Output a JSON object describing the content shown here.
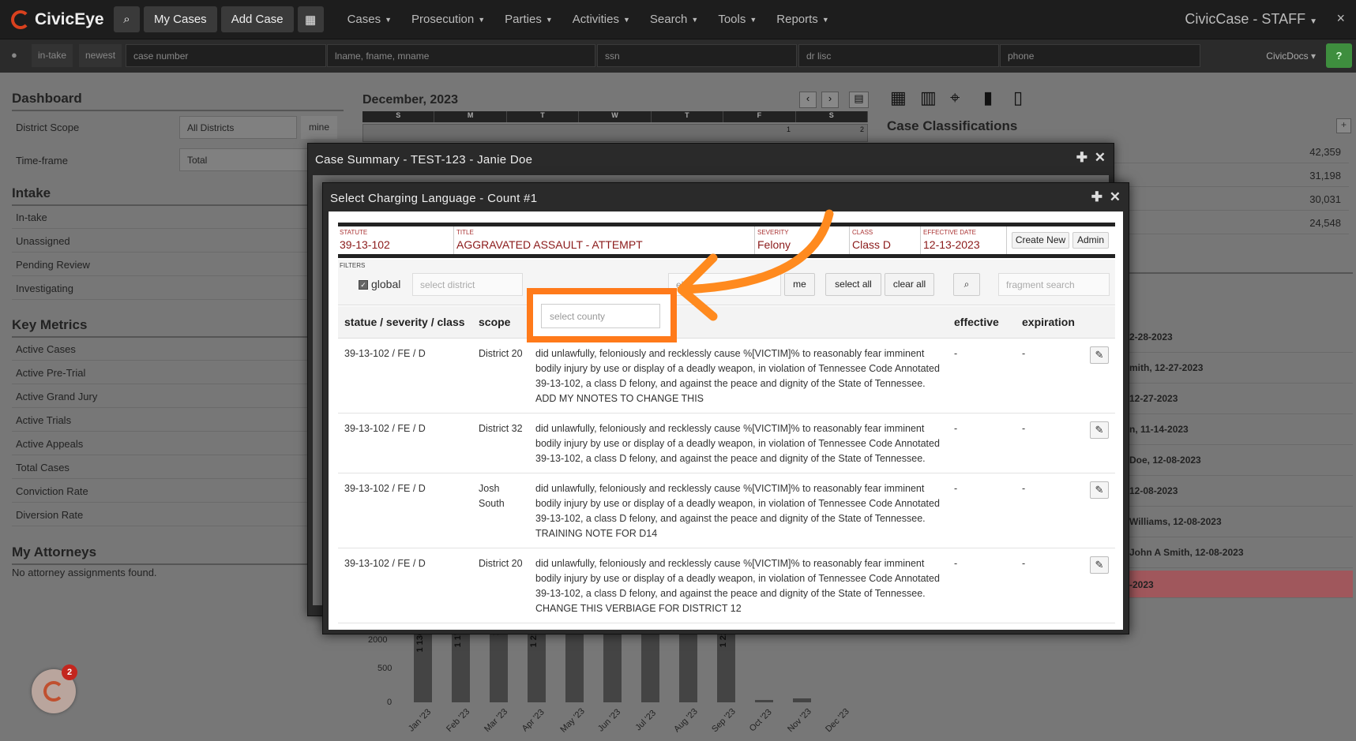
{
  "nav": {
    "brand": "CivicEye",
    "my_cases": "My Cases",
    "add_case": "Add Case",
    "menus": [
      "Cases",
      "Prosecution",
      "Parties",
      "Activities",
      "Search",
      "Tools",
      "Reports"
    ],
    "app_title": "CivicCase - STAFF",
    "close": "×"
  },
  "search_bar": {
    "in_take": "in-take",
    "newest": "newest",
    "placeholders": [
      "case number",
      "lname, fname, mname",
      "ssn",
      "dr lisc",
      "phone"
    ],
    "docs": "CivicDocs",
    "help": "?"
  },
  "dashboard": {
    "title": "Dashboard",
    "district_scope_label": "District Scope",
    "district_scope_value": "All Districts",
    "mine": "mine",
    "timeframe_label": "Time-frame",
    "timeframe_value": "Total",
    "intake_title": "Intake",
    "intake": [
      "In-take",
      "Unassigned",
      "Pending Review",
      "Investigating"
    ],
    "metrics_title": "Key Metrics",
    "metrics": [
      "Active Cases",
      "Active Pre-Trial",
      "Active Grand Jury",
      "Active Trials",
      "Active Appeals",
      "Total Cases",
      "Conviction Rate",
      "Diversion Rate"
    ],
    "total_cases_partial": "2",
    "attorneys_title": "My Attorneys",
    "attorneys_empty": "No attorney assignments found."
  },
  "calendar": {
    "month": "December, 2023",
    "days": [
      "S",
      "M",
      "T",
      "W",
      "T",
      "F",
      "S"
    ],
    "dates": [
      "1",
      "2"
    ]
  },
  "classifications": {
    "title": "Case Classifications",
    "add": "+",
    "values": [
      "42,359",
      "31,198",
      "30,031",
      "24,548"
    ]
  },
  "activity": [
    "2-28-2023",
    "mith, 12-27-2023",
    "12-27-2023",
    "n, 11-14-2023",
    "Doe, 12-08-2023",
    "12-08-2023",
    "Williams, 12-08-2023",
    "John A Smith, 12-08-2023",
    "-2023"
  ],
  "chart_data": {
    "type": "bar",
    "y_ticks": [
      "0",
      "500",
      "2000"
    ],
    "categories": [
      "Jan '23",
      "Feb '23",
      "Mar '23",
      "Apr '23",
      "May '23",
      "Jun '23",
      "Jul '23",
      "Aug '23",
      "Sep '23",
      "Oct '23",
      "Nov '23",
      "Dec '23"
    ],
    "bar_labels": [
      "1 136",
      "1 17",
      "1",
      "1 21",
      "",
      "",
      "",
      "",
      "1 22",
      "",
      "",
      ""
    ]
  },
  "modal1": {
    "title": "Case Summary - TEST-123 - Janie Doe"
  },
  "modal2": {
    "title": "Select Charging Language - Count #1",
    "statute_label": "Statute",
    "statute": "39-13-102",
    "title_label": "Title",
    "title_value": "AGGRAVATED ASSAULT - ATTEMPT",
    "severity_label": "Severity",
    "severity": "Felony",
    "class_label": "Class",
    "class_value": "Class D",
    "effective_label": "Effective Date",
    "effective": "12-13-2023",
    "create_new": "Create New",
    "admin": "Admin",
    "filters_label": "FILTERS",
    "global": "global",
    "district_ph": "select district",
    "county_ph": "select county",
    "el_partial": "el",
    "me": "me",
    "select_all": "select all",
    "clear_all": "clear all",
    "fragment_ph": "fragment search",
    "columns": [
      "statue / severity / class",
      "scope",
      "text / notes",
      "effective",
      "expiration"
    ],
    "rows": [
      {
        "code": "39-13-102 / FE / D",
        "scope": "District 20",
        "text": "did unlawfully, feloniously and recklessly cause %[VICTIM]% to reasonably fear imminent bodily injury by use or display of a deadly weapon, in violation of Tennessee Code Annotated 39-13-102, a class D felony, and against the peace and dignity of the State of Tennessee. ADD MY NNOTES TO CHANGE THIS",
        "effective": "-",
        "expiration": "-"
      },
      {
        "code": "39-13-102 / FE / D",
        "scope": "District 32",
        "text": "did unlawfully, feloniously and recklessly cause %[VICTIM]% to reasonably fear imminent bodily injury by use or display of a deadly weapon, in violation of Tennessee Code Annotated 39-13-102, a class D felony, and against the peace and dignity of the State of Tennessee.",
        "effective": "-",
        "expiration": "-"
      },
      {
        "code": "39-13-102 / FE / D",
        "scope": "Josh South",
        "text": "did unlawfully, feloniously and recklessly cause %[VICTIM]% to reasonably fear imminent bodily injury by use or display of a deadly weapon, in violation of Tennessee Code Annotated 39-13-102, a class D felony, and against the peace and dignity of the State of Tennessee. TRAINING NOTE FOR D14",
        "effective": "-",
        "expiration": "-"
      },
      {
        "code": "39-13-102 / FE / D",
        "scope": "District 20",
        "text": "did unlawfully, feloniously and recklessly cause %[VICTIM]% to reasonably fear imminent bodily injury by use or display of a deadly weapon, in violation of Tennessee Code Annotated 39-13-102, a class D felony, and against the peace and dignity of the State of Tennessee. CHANGE THIS VERBIAGE FOR DISTRICT 12",
        "effective": "-",
        "expiration": "-"
      }
    ]
  },
  "notification_badge": "2",
  "colors": {
    "navbar": "#1d1d1d",
    "accent_highlight": "#ff7a1a",
    "brand_red": "#d9411e",
    "statute_text": "#8b1a1a"
  }
}
